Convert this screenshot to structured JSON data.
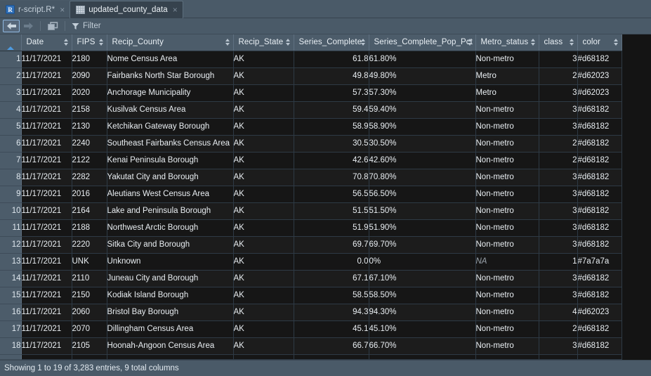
{
  "tabs": [
    {
      "label": "r-script.R*",
      "icon": "r-file-icon",
      "active": false,
      "close": "×"
    },
    {
      "label": "updated_county_data",
      "icon": "table-grid-icon",
      "active": true,
      "close": "×"
    }
  ],
  "toolbar": {
    "back_icon": "back-arrow-icon",
    "forward_icon": "forward-arrow-icon",
    "popout_icon": "open-in-new-window-icon",
    "filter_icon": "funnel-icon",
    "filter_label": "Filter"
  },
  "grid": {
    "gutter_sort_icon": "sort-ascending-triangle-icon",
    "columns": [
      {
        "key": "date",
        "label": "Date",
        "align": "left",
        "cls": "c-date"
      },
      {
        "key": "fips",
        "label": "FIPS",
        "align": "left",
        "cls": "c-fips"
      },
      {
        "key": "county",
        "label": "Recip_County",
        "align": "left",
        "cls": "c-county"
      },
      {
        "key": "state",
        "label": "Recip_State",
        "align": "left",
        "cls": "c-state"
      },
      {
        "key": "sc",
        "label": "Series_Complete",
        "align": "right",
        "cls": "c-sc"
      },
      {
        "key": "scpp",
        "label": "Series_Complete_Pop_Pct",
        "align": "left",
        "cls": "c-scpp"
      },
      {
        "key": "metro",
        "label": "Metro_status",
        "align": "left",
        "cls": "c-metro"
      },
      {
        "key": "class",
        "label": "class",
        "align": "right",
        "cls": "c-class"
      },
      {
        "key": "color",
        "label": "color",
        "align": "left",
        "cls": "c-color"
      }
    ],
    "rows": [
      {
        "n": "1",
        "date": "11/17/2021",
        "fips": "2180",
        "county": "Nome Census Area",
        "state": "AK",
        "sc": "61.8",
        "scpp": "61.80%",
        "metro": "Non-metro",
        "class": "3",
        "color": "#d68182"
      },
      {
        "n": "2",
        "date": "11/17/2021",
        "fips": "2090",
        "county": "Fairbanks North Star Borough",
        "state": "AK",
        "sc": "49.8",
        "scpp": "49.80%",
        "metro": "Metro",
        "class": "2",
        "color": "#d62023"
      },
      {
        "n": "3",
        "date": "11/17/2021",
        "fips": "2020",
        "county": "Anchorage Municipality",
        "state": "AK",
        "sc": "57.3",
        "scpp": "57.30%",
        "metro": "Metro",
        "class": "3",
        "color": "#d62023"
      },
      {
        "n": "4",
        "date": "11/17/2021",
        "fips": "2158",
        "county": "Kusilvak Census Area",
        "state": "AK",
        "sc": "59.4",
        "scpp": "59.40%",
        "metro": "Non-metro",
        "class": "3",
        "color": "#d68182"
      },
      {
        "n": "5",
        "date": "11/17/2021",
        "fips": "2130",
        "county": "Ketchikan Gateway Borough",
        "state": "AK",
        "sc": "58.9",
        "scpp": "58.90%",
        "metro": "Non-metro",
        "class": "3",
        "color": "#d68182"
      },
      {
        "n": "6",
        "date": "11/17/2021",
        "fips": "2240",
        "county": "Southeast Fairbanks Census Area",
        "state": "AK",
        "sc": "30.5",
        "scpp": "30.50%",
        "metro": "Non-metro",
        "class": "2",
        "color": "#d68182"
      },
      {
        "n": "7",
        "date": "11/17/2021",
        "fips": "2122",
        "county": "Kenai Peninsula Borough",
        "state": "AK",
        "sc": "42.6",
        "scpp": "42.60%",
        "metro": "Non-metro",
        "class": "2",
        "color": "#d68182"
      },
      {
        "n": "8",
        "date": "11/17/2021",
        "fips": "2282",
        "county": "Yakutat City and Borough",
        "state": "AK",
        "sc": "70.8",
        "scpp": "70.80%",
        "metro": "Non-metro",
        "class": "3",
        "color": "#d68182"
      },
      {
        "n": "9",
        "date": "11/17/2021",
        "fips": "2016",
        "county": "Aleutians West Census Area",
        "state": "AK",
        "sc": "56.5",
        "scpp": "56.50%",
        "metro": "Non-metro",
        "class": "3",
        "color": "#d68182"
      },
      {
        "n": "10",
        "date": "11/17/2021",
        "fips": "2164",
        "county": "Lake and Peninsula Borough",
        "state": "AK",
        "sc": "51.5",
        "scpp": "51.50%",
        "metro": "Non-metro",
        "class": "3",
        "color": "#d68182"
      },
      {
        "n": "11",
        "date": "11/17/2021",
        "fips": "2188",
        "county": "Northwest Arctic Borough",
        "state": "AK",
        "sc": "51.9",
        "scpp": "51.90%",
        "metro": "Non-metro",
        "class": "3",
        "color": "#d68182"
      },
      {
        "n": "12",
        "date": "11/17/2021",
        "fips": "2220",
        "county": "Sitka City and Borough",
        "state": "AK",
        "sc": "69.7",
        "scpp": "69.70%",
        "metro": "Non-metro",
        "class": "3",
        "color": "#d68182"
      },
      {
        "n": "13",
        "date": "11/17/2021",
        "fips": "UNK",
        "county": "Unknown",
        "state": "AK",
        "sc": "0.0",
        "scpp": "0%",
        "metro": "NA",
        "class": "1",
        "color": "#7a7a7a",
        "metro_na": true
      },
      {
        "n": "14",
        "date": "11/17/2021",
        "fips": "2110",
        "county": "Juneau City and Borough",
        "state": "AK",
        "sc": "67.1",
        "scpp": "67.10%",
        "metro": "Non-metro",
        "class": "3",
        "color": "#d68182"
      },
      {
        "n": "15",
        "date": "11/17/2021",
        "fips": "2150",
        "county": "Kodiak Island Borough",
        "state": "AK",
        "sc": "58.5",
        "scpp": "58.50%",
        "metro": "Non-metro",
        "class": "3",
        "color": "#d68182"
      },
      {
        "n": "16",
        "date": "11/17/2021",
        "fips": "2060",
        "county": "Bristol Bay Borough",
        "state": "AK",
        "sc": "94.3",
        "scpp": "94.30%",
        "metro": "Non-metro",
        "class": "4",
        "color": "#d62023"
      },
      {
        "n": "17",
        "date": "11/17/2021",
        "fips": "2070",
        "county": "Dillingham Census Area",
        "state": "AK",
        "sc": "45.1",
        "scpp": "45.10%",
        "metro": "Non-metro",
        "class": "2",
        "color": "#d68182"
      },
      {
        "n": "18",
        "date": "11/17/2021",
        "fips": "2105",
        "county": "Hoonah-Angoon Census Area",
        "state": "AK",
        "sc": "66.7",
        "scpp": "66.70%",
        "metro": "Non-metro",
        "class": "3",
        "color": "#d68182"
      }
    ]
  },
  "statusbar": {
    "text": "Showing 1 to 19 of 3,283 entries, 9 total columns"
  },
  "colors": {
    "chrome": "#4a5a68",
    "header": "#4c5c6a",
    "row_odd": "#161616",
    "row_even": "#1c1c1c",
    "accent": "#4d9ae0"
  }
}
